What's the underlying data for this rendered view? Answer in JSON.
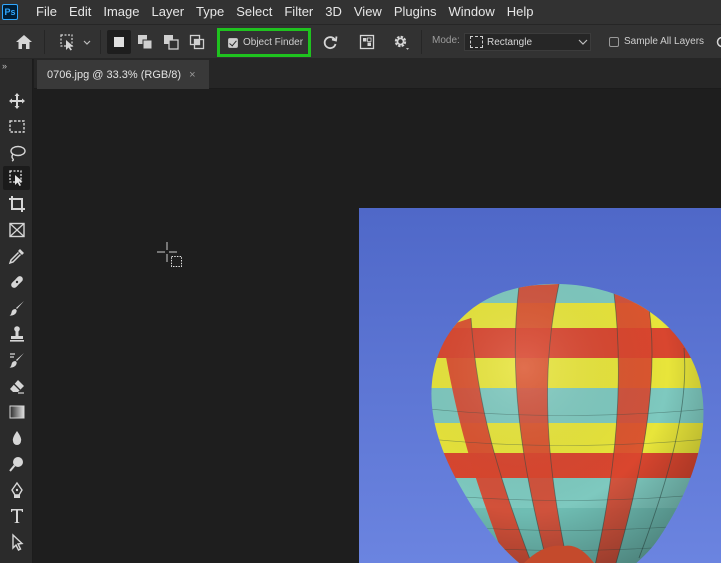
{
  "app": {
    "logo_text": "Ps",
    "menu": [
      "File",
      "Edit",
      "Image",
      "Layer",
      "Type",
      "Select",
      "Filter",
      "3D",
      "View",
      "Plugins",
      "Window",
      "Help"
    ]
  },
  "options_bar": {
    "object_finder_label": "Object Finder",
    "object_finder_checked": true,
    "mode_label": "Mode:",
    "mode_value": "Rectangle",
    "sample_all_layers_label": "Sample All Layers",
    "sample_all_layers_checked": false,
    "highlight_color": "#1fc21f"
  },
  "document": {
    "tab_title": "0706.jpg @ 33.3% (RGB/8)",
    "close_glyph": "×"
  },
  "toolbar": {
    "collapse_glyph": "»",
    "tools": [
      {
        "name": "move-tool"
      },
      {
        "name": "rectangular-marquee-tool"
      },
      {
        "name": "lasso-tool"
      },
      {
        "name": "object-selection-tool",
        "active": true
      },
      {
        "name": "crop-tool"
      },
      {
        "name": "frame-tool"
      },
      {
        "name": "eyedropper-tool"
      },
      {
        "name": "spot-healing-brush-tool"
      },
      {
        "name": "brush-tool"
      },
      {
        "name": "clone-stamp-tool"
      },
      {
        "name": "history-brush-tool"
      },
      {
        "name": "eraser-tool"
      },
      {
        "name": "gradient-tool"
      },
      {
        "name": "blur-tool"
      },
      {
        "name": "dodge-tool"
      },
      {
        "name": "pen-tool"
      },
      {
        "name": "type-tool"
      },
      {
        "name": "path-selection-tool"
      }
    ]
  },
  "colors": {
    "ui_bg": "#323232",
    "canvas_bg": "#1e1e1e",
    "sky": "#5f78d6"
  }
}
